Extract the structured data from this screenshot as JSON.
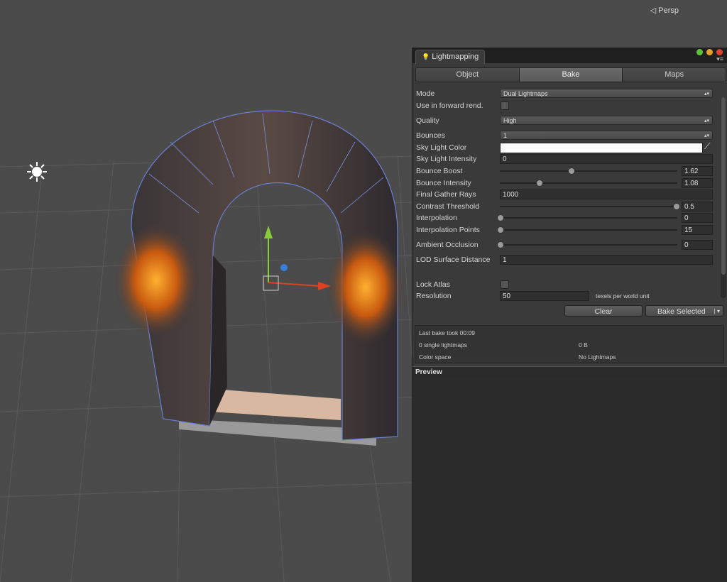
{
  "scene": {
    "projection_label": "◁ Persp",
    "icons": {
      "sun": "sun-icon",
      "gizmo": "move-gizmo-icon"
    }
  },
  "window": {
    "title": "Lightmapping",
    "tabs": [
      {
        "label": "Object",
        "active": false
      },
      {
        "label": "Bake",
        "active": true
      },
      {
        "label": "Maps",
        "active": false
      }
    ],
    "settings": {
      "mode": {
        "label": "Mode",
        "value": "Dual Lightmaps"
      },
      "forward": {
        "label": "Use in forward rend.",
        "checked": false
      },
      "quality": {
        "label": "Quality",
        "value": "High"
      },
      "bounces": {
        "label": "Bounces",
        "value": "1"
      },
      "sky_color": {
        "label": "Sky Light Color",
        "color": "#ffffff"
      },
      "sky_intensity": {
        "label": "Sky Light Intensity",
        "value": "0"
      },
      "bounce_boost": {
        "label": "Bounce Boost",
        "value": "1.62",
        "slider": 0.4
      },
      "bounce_intensity": {
        "label": "Bounce Intensity",
        "value": "1.08",
        "slider": 0.22
      },
      "final_gather": {
        "label": "Final Gather Rays",
        "value": "1000"
      },
      "contrast": {
        "label": "Contrast Threshold",
        "value": "0.5",
        "slider": 0.99
      },
      "interpolation": {
        "label": "Interpolation",
        "value": "0",
        "slider": 0.0
      },
      "interp_points": {
        "label": "Interpolation Points",
        "value": "15",
        "slider": 0.0
      },
      "ao": {
        "label": "Ambient Occlusion",
        "value": "0",
        "slider": 0.0
      },
      "lod": {
        "label": "LOD Surface Distance",
        "value": "1"
      },
      "lock_atlas": {
        "label": "Lock Atlas",
        "checked": false
      },
      "resolution": {
        "label": "Resolution",
        "value": "50",
        "unit": "texels per world unit"
      }
    },
    "buttons": {
      "clear": "Clear",
      "bake_selected": "Bake Selected"
    },
    "status": {
      "last_bake": "Last bake took 00:09",
      "lightmaps": "0 single lightmaps",
      "size": "0 B",
      "color_space_label": "Color space",
      "color_space_value": "No Lightmaps"
    },
    "preview_label": "Preview"
  }
}
